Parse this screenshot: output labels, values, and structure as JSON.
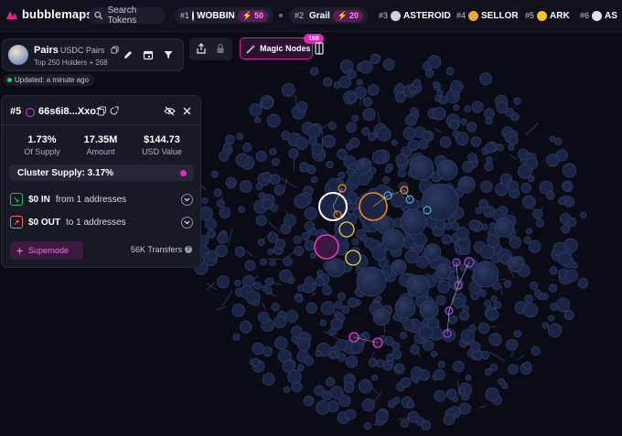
{
  "app": {
    "brand": "bubblemaps"
  },
  "search": {
    "label": "Search Tokens"
  },
  "trending": [
    {
      "rank": "#1",
      "name": "WOBBIN",
      "boost": "50",
      "color": "#e7e7ef"
    },
    {
      "rank": "#2",
      "name": "Grail",
      "boost": "20",
      "color": "#d6b07a"
    },
    {
      "rank": "#3",
      "name": "ASTEROID",
      "color": "#cfd3e0"
    },
    {
      "rank": "#4",
      "name": "SELLOR",
      "color": "#f0a640"
    },
    {
      "rank": "#5",
      "name": "ARK",
      "color": "#f2c230"
    },
    {
      "rank": "#6",
      "name": "AS",
      "color": "#dfe1ea"
    }
  ],
  "token": {
    "name": "Pairs",
    "pair": "USDC Pairs",
    "holders": "Top 250 Holders + 268",
    "updated": "Updated: a minute ago"
  },
  "toolbar": {
    "magic_nodes": "Magic Nodes",
    "magic_count": "168"
  },
  "wallet": {
    "rank": "#5",
    "address": "66s6i8...Xxo1",
    "stats": [
      {
        "value": "1.73%",
        "label": "Of Supply"
      },
      {
        "value": "17.35M",
        "label": "Amount"
      },
      {
        "value": "$144.73",
        "label": "USD Value"
      }
    ],
    "cluster_supply": "Cluster Supply: 3.17%",
    "in": {
      "amount": "$0 IN",
      "desc": "from 1 addresses"
    },
    "out": {
      "amount": "$0 OUT",
      "desc": "to 1 addresses"
    },
    "supernode": "Supernode",
    "transfers": "56K Transfers"
  },
  "colors": {
    "accent": "#e02bc2",
    "in": "#1fb86a",
    "out": "#ff6a4a",
    "bubble": "#1f2a4a"
  },
  "icons": [
    "search-icon",
    "copy-icon",
    "edit-icon",
    "calendar-icon",
    "filter-icon",
    "share-icon",
    "lock-icon",
    "magic-wand-icon",
    "sidebar-icon",
    "eye-off-icon",
    "close-icon",
    "external-icon",
    "chevron-down-icon",
    "help-icon"
  ]
}
